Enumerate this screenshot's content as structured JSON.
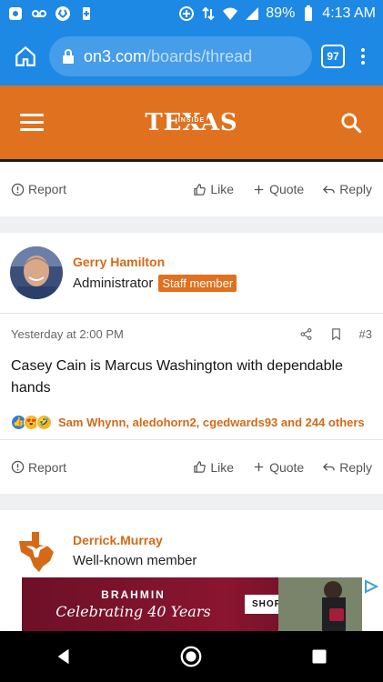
{
  "status_bar": {
    "battery": "89%",
    "time": "4:13 AM"
  },
  "browser": {
    "url_host": "on3.com",
    "url_path": "/boards/thread",
    "tab_count": "97"
  },
  "site": {
    "logo_text": "TEXAS",
    "logo_sub": "INSIDE",
    "brand_color": "#e0711f"
  },
  "prev_post_actions": {
    "report": "Report",
    "like": "Like",
    "quote": "Quote",
    "reply": "Reply"
  },
  "post": {
    "author": "Gerry Hamilton",
    "role": "Administrator",
    "badge": "Staff member",
    "timestamp": "Yesterday at 2:00 PM",
    "number": "#3",
    "body": "Casey Cain is Marcus Washington with dependable hands",
    "reactions_text": "Sam Whynn, aledohorn2, cgedwards93 and 244 others",
    "actions": {
      "report": "Report",
      "like": "Like",
      "quote": "Quote",
      "reply": "Reply"
    }
  },
  "next_post": {
    "author": "Derrick.Murray",
    "role": "Well-known member"
  },
  "ad": {
    "brand": "BRAHMIN",
    "tagline": "Celebrating 40 Years",
    "cta": "SHOP NOW"
  }
}
